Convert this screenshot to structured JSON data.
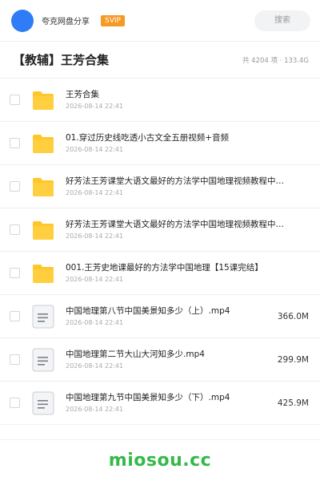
{
  "header": {
    "brand": "夸克网盘分享",
    "badge": "SVIP",
    "search_label": "搜索"
  },
  "titlebar": {
    "title": "【教辅】王芳合集",
    "meta": "共 4204 项 · 133.4G"
  },
  "colors": {
    "accent": "#2f7cf6",
    "svip": "#f59a23",
    "folder": "#ffc629",
    "watermark": "#36b84a"
  },
  "items": [
    {
      "type": "folder",
      "icon": "folder-icon",
      "name": "王芳合集",
      "date": "2026-08-14 22:41",
      "size": ""
    },
    {
      "type": "folder",
      "icon": "folder-icon",
      "name": "01.穿过历史线吃透小古文全五册视频+音频",
      "date": "2026-08-14 22:41",
      "size": ""
    },
    {
      "type": "folder",
      "icon": "folder-icon",
      "name": "好芳法王芳课堂大语文最好的方法学中国地理视频教程中…",
      "date": "2026-08-14 22:41",
      "size": ""
    },
    {
      "type": "folder",
      "icon": "folder-icon",
      "name": "好芳法王芳课堂大语文最好的方法学中国地理视频教程中…",
      "date": "2026-08-14 22:41",
      "size": ""
    },
    {
      "type": "folder",
      "icon": "folder-icon",
      "name": "001.王芳史地课最好的方法学中国地理【15课完结】",
      "date": "2026-08-14 22:41",
      "size": ""
    },
    {
      "type": "file",
      "icon": "document-icon",
      "name": "中国地理第八节中国美景知多少（上）.mp4",
      "date": "2026-08-14 22:41",
      "size": "366.0M"
    },
    {
      "type": "file",
      "icon": "document-icon",
      "name": "中国地理第二节大山大河知多少.mp4",
      "date": "2026-08-14 22:41",
      "size": "299.9M"
    },
    {
      "type": "file",
      "icon": "document-icon",
      "name": "中国地理第九节中国美景知多少（下）.mp4",
      "date": "2026-08-14 22:41",
      "size": "425.9M"
    }
  ],
  "watermark": "miosou.cc"
}
